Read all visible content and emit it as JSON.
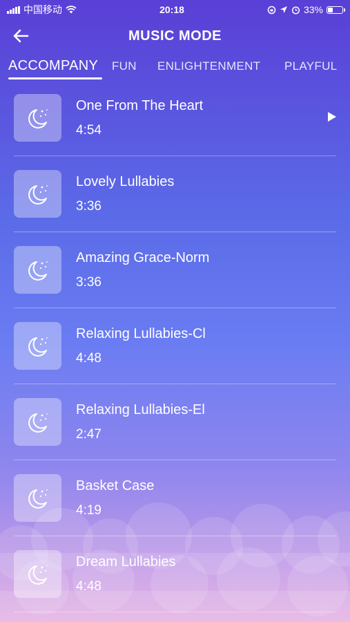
{
  "status_bar": {
    "carrier": "中国移动",
    "time": "20:18",
    "battery_percent": "33%",
    "battery_level": 0.33
  },
  "header": {
    "title": "MUSIC MODE",
    "back_icon": "arrow-left-icon"
  },
  "tabs": [
    {
      "label": "ACCOMPANY",
      "active": true
    },
    {
      "label": "FUN",
      "active": false
    },
    {
      "label": "ENLIGHTENMENT",
      "active": false
    },
    {
      "label": "PLAYFUL",
      "active": false
    }
  ],
  "songs": [
    {
      "title": "One From The Heart",
      "duration": "4:54",
      "playing": true
    },
    {
      "title": "Lovely Lullabies",
      "duration": "3:36",
      "playing": false
    },
    {
      "title": "Amazing Grace-Norm",
      "duration": "3:36",
      "playing": false
    },
    {
      "title": "Relaxing Lullabies-Cl",
      "duration": "4:48",
      "playing": false
    },
    {
      "title": "Relaxing Lullabies-El",
      "duration": "2:47",
      "playing": false
    },
    {
      "title": "Basket Case",
      "duration": "4:19",
      "playing": false
    },
    {
      "title": "Dream Lullabies",
      "duration": "4:48",
      "playing": false
    }
  ],
  "icons": {
    "thumbnail": "moon-stars-icon",
    "play": "play-icon"
  },
  "colors": {
    "gradient_top": "#5a3fd6",
    "gradient_bottom": "#e2a9e0",
    "text": "#ffffff"
  }
}
